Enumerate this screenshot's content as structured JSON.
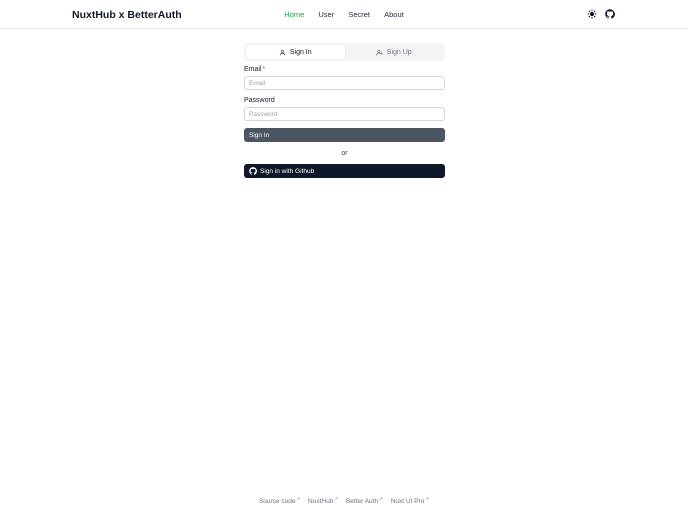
{
  "header": {
    "brand": "NuxtHub x BetterAuth",
    "nav": [
      {
        "label": "Home",
        "active": true
      },
      {
        "label": "User",
        "active": false
      },
      {
        "label": "Secret",
        "active": false
      },
      {
        "label": "About",
        "active": false
      }
    ],
    "icons": [
      "sun-icon",
      "github-icon"
    ]
  },
  "auth": {
    "tabs": [
      {
        "label": "Sign In",
        "icon": "user-icon",
        "active": true
      },
      {
        "label": "Sign Up",
        "icon": "user-plus-icon",
        "active": false
      }
    ],
    "email_label": "Email",
    "email_required": "*",
    "email_placeholder": "Email",
    "password_label": "Password",
    "password_placeholder": "Password",
    "signin_label": "Sign In",
    "or_label": "or",
    "github_label": "Sign in with Github"
  },
  "footer": {
    "links": [
      {
        "label": "Source code",
        "ext": "↗"
      },
      {
        "label": "NuxtHub",
        "ext": "↗"
      },
      {
        "label": "Better Auth",
        "ext": "↗"
      },
      {
        "label": "Nuxt UI Pro",
        "ext": "↗"
      }
    ]
  },
  "colors": {
    "accent": "#16a34a",
    "primary_button": "#4b5563",
    "github_button": "#0f172a",
    "required": "#ef4444"
  }
}
